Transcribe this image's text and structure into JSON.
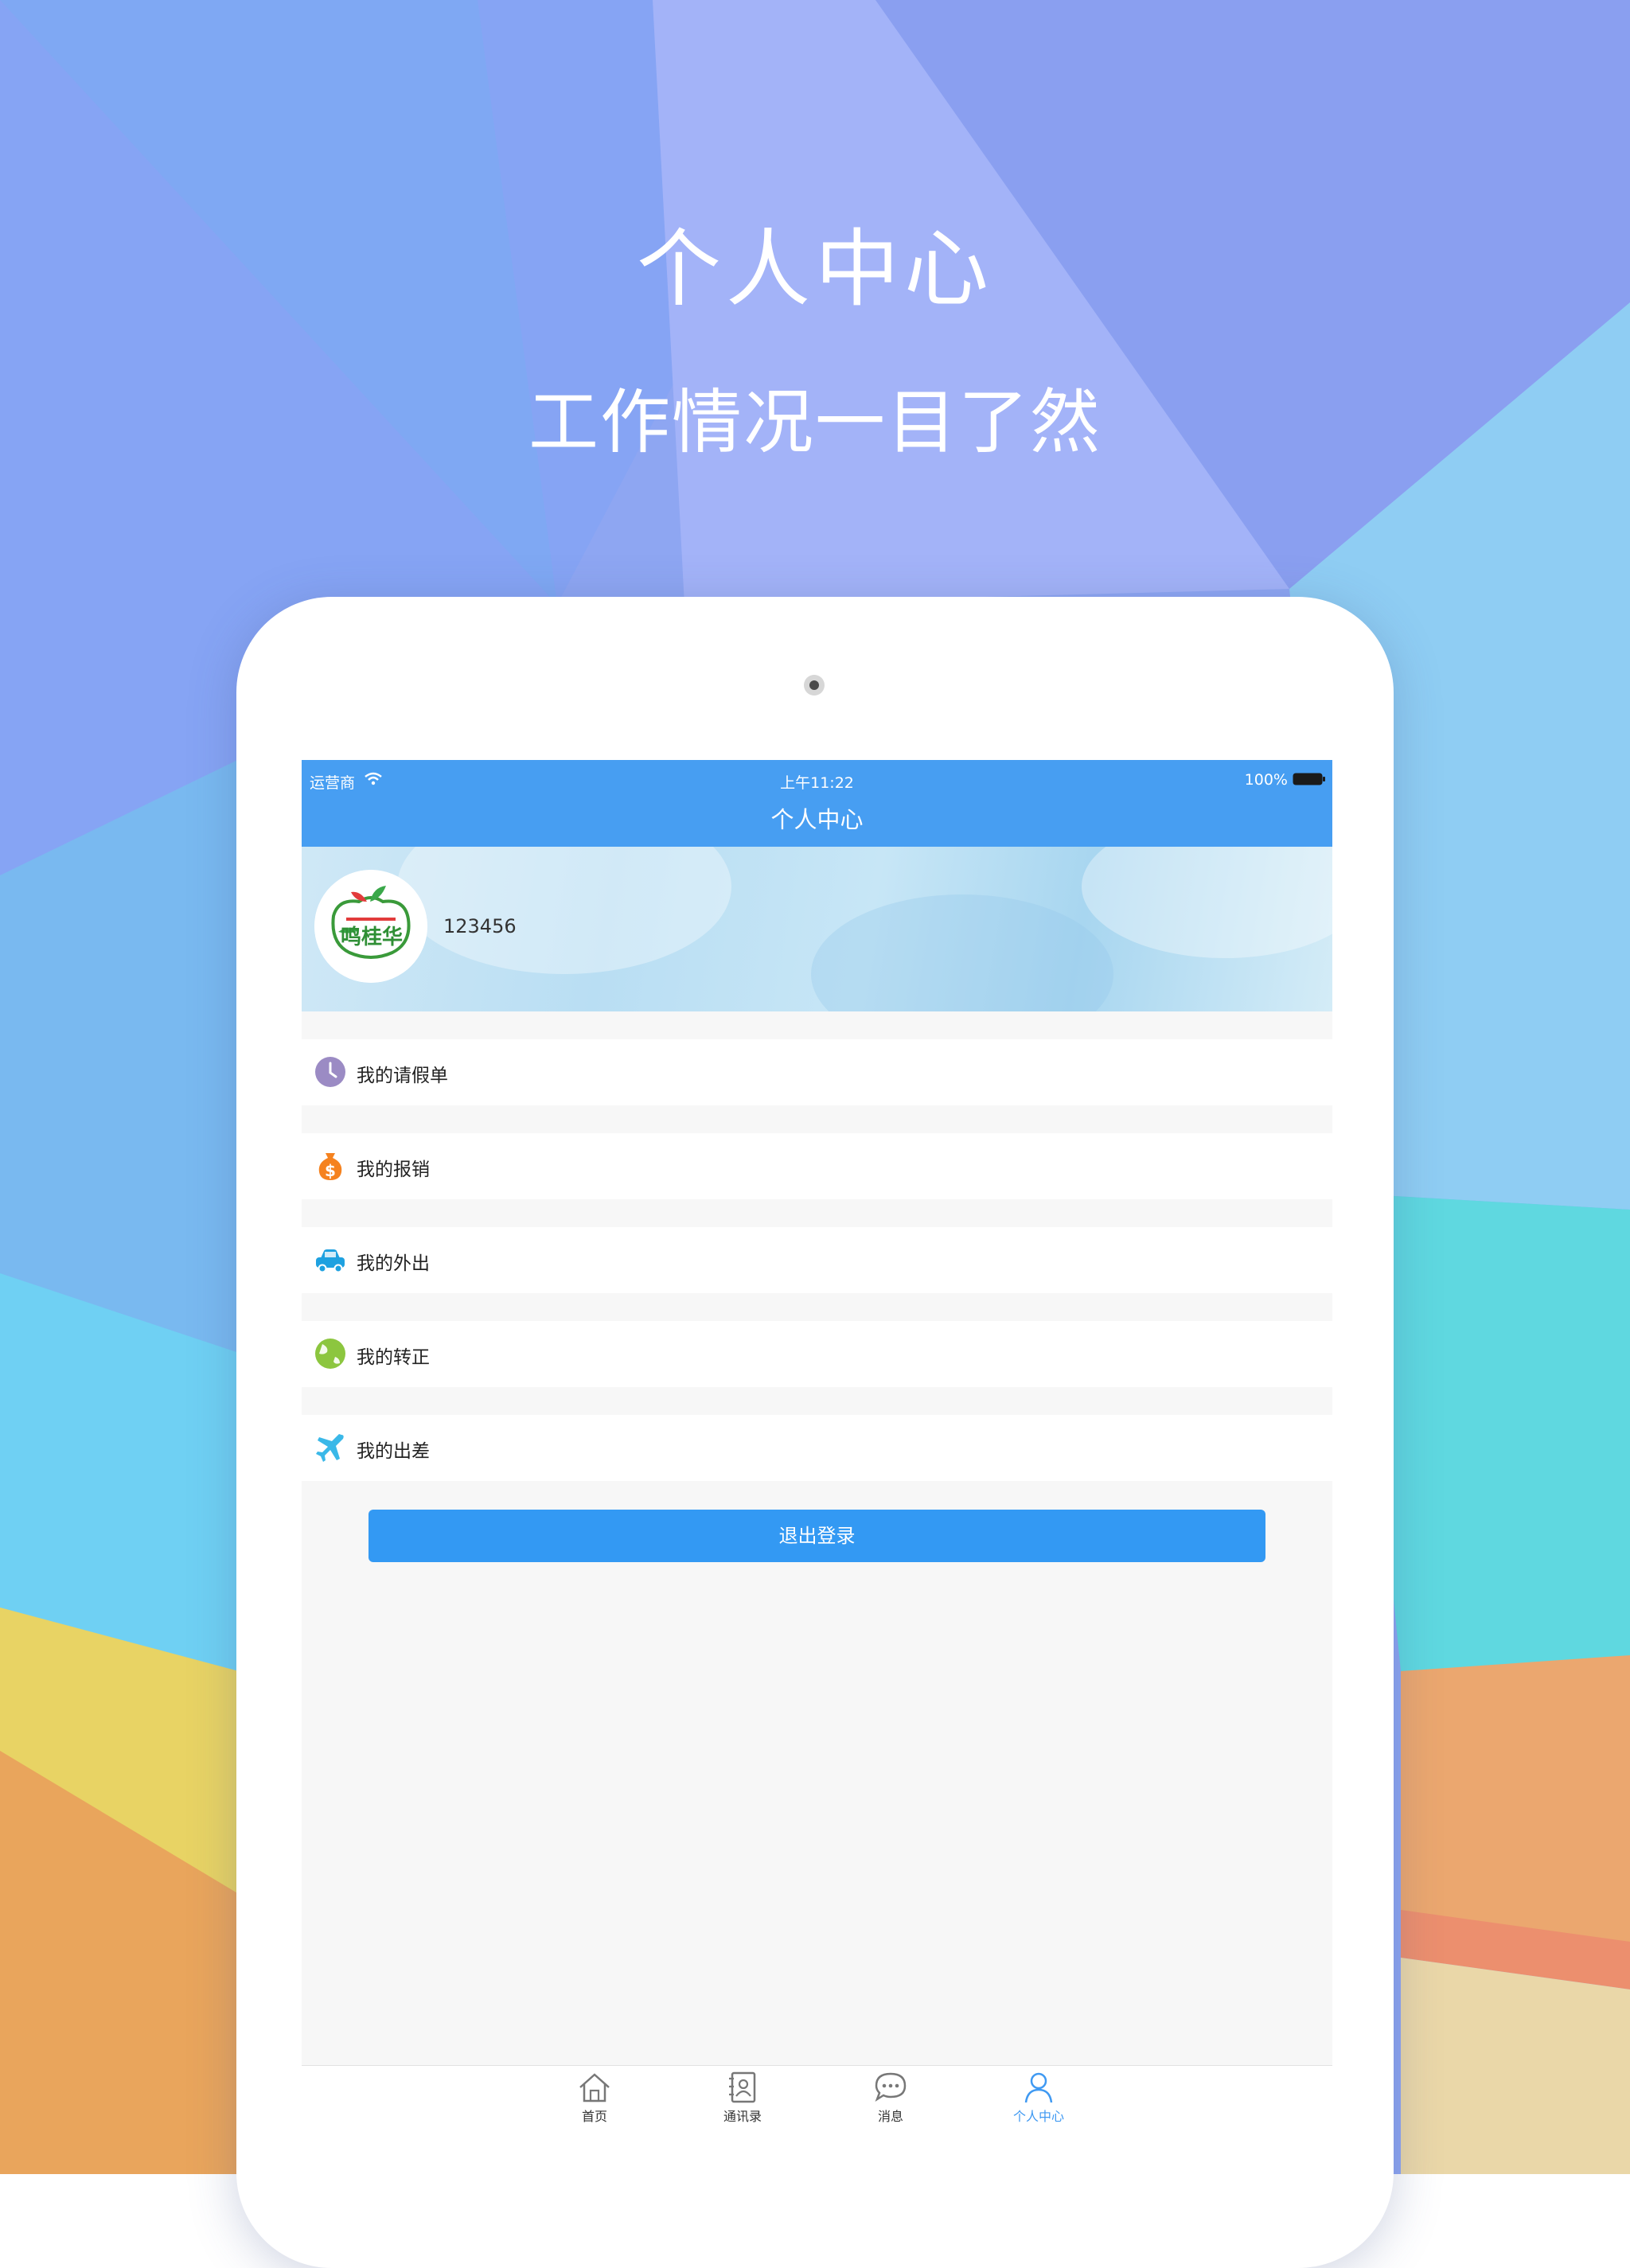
{
  "promo": {
    "headline": "个人中心",
    "subline": "工作情况一目了然"
  },
  "status_bar": {
    "carrier": "运营商",
    "time": "上午11:22",
    "battery": "100%"
  },
  "nav": {
    "title": "个人中心"
  },
  "profile": {
    "username": "123456",
    "avatar_text": "鸣桂华"
  },
  "menu": {
    "items": [
      {
        "label": "我的请假单",
        "icon": "clock-icon",
        "color": "#9b8bc4"
      },
      {
        "label": "我的报销",
        "icon": "money-bag-icon",
        "color": "#f5821f"
      },
      {
        "label": "我的外出",
        "icon": "car-icon",
        "color": "#1ea1e0"
      },
      {
        "label": "我的转正",
        "icon": "globe-icon",
        "color": "#8cc63f"
      },
      {
        "label": "我的出差",
        "icon": "airplane-icon",
        "color": "#3ab8e8"
      }
    ]
  },
  "logout": {
    "label": "退出登录"
  },
  "tabbar": {
    "tabs": [
      {
        "label": "首页",
        "icon": "home-icon",
        "active": false
      },
      {
        "label": "通讯录",
        "icon": "contacts-icon",
        "active": false
      },
      {
        "label": "消息",
        "icon": "message-icon",
        "active": false
      },
      {
        "label": "个人中心",
        "icon": "person-icon",
        "active": true
      }
    ]
  },
  "colors": {
    "accent": "#479ef2",
    "button": "#3399f3",
    "active_tab": "#3f99f2"
  }
}
